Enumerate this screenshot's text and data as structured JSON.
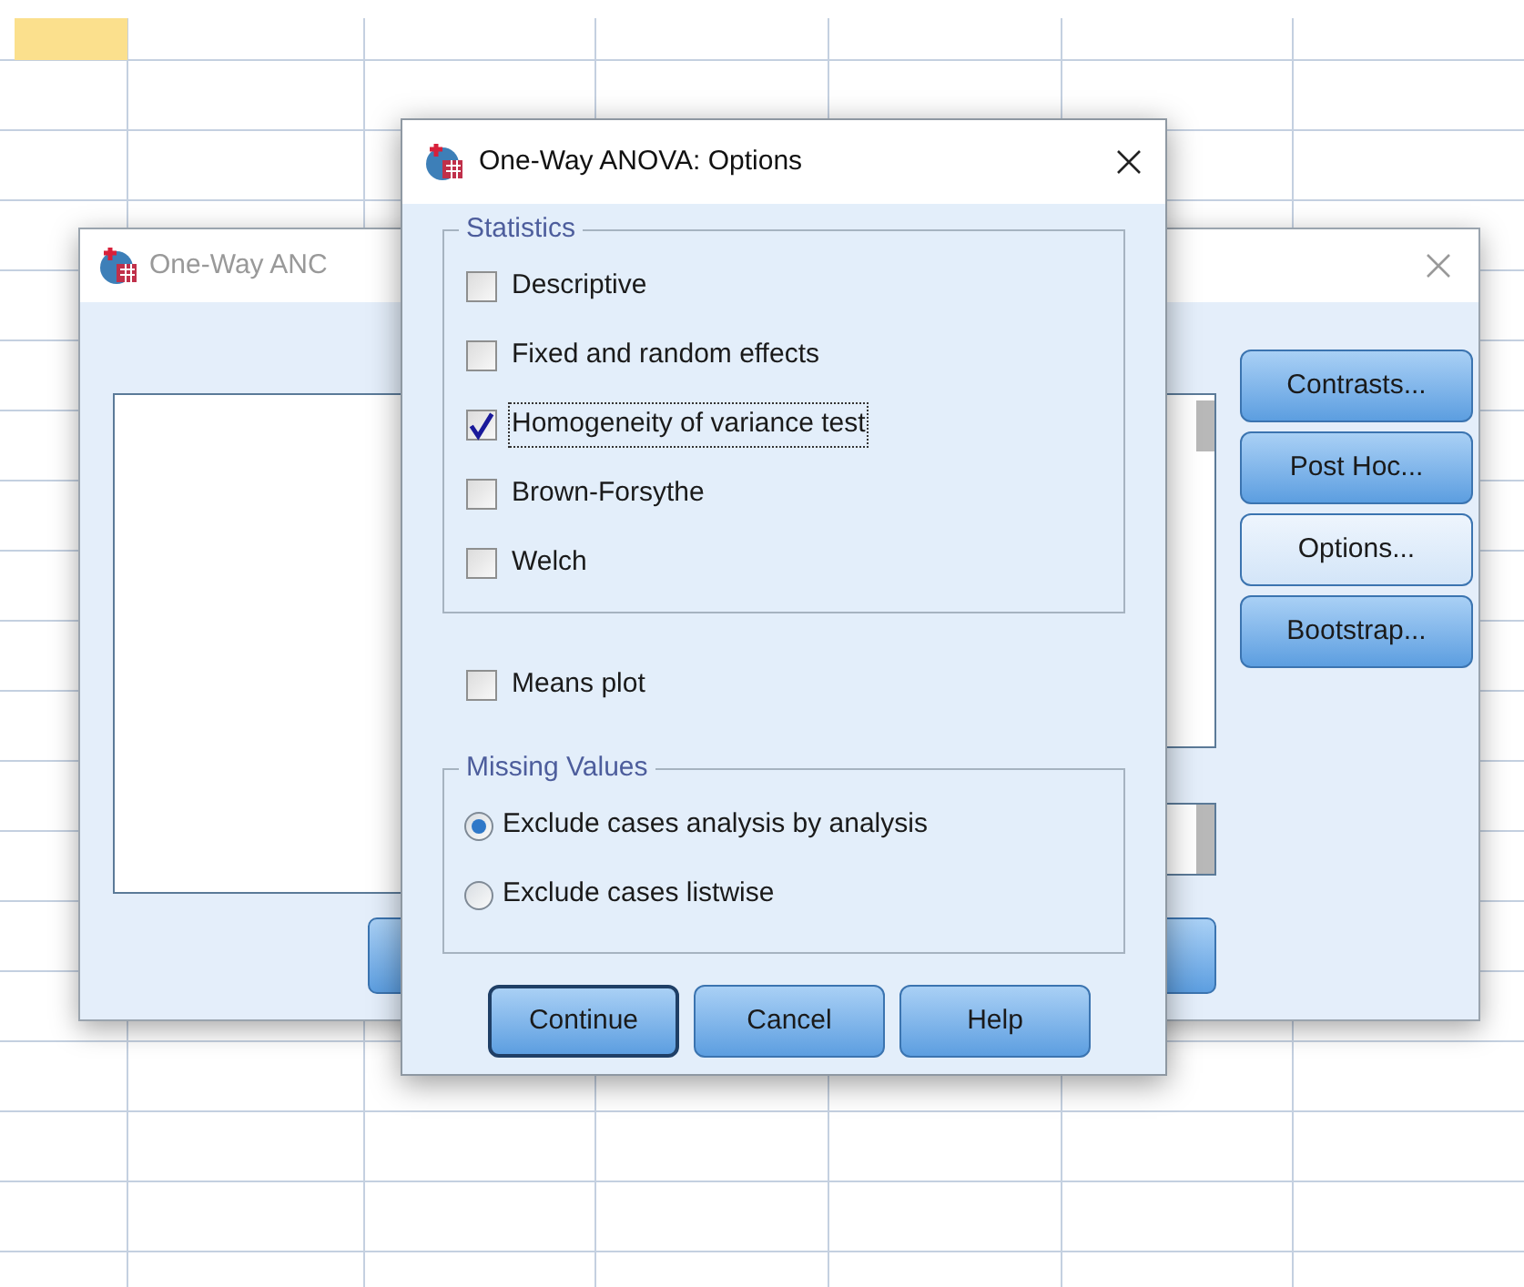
{
  "main_window": {
    "title": "One-Way ANC",
    "buttons": [
      {
        "label": "Contrasts...",
        "selected": false
      },
      {
        "label": "Post Hoc...",
        "selected": false
      },
      {
        "label": "Options...",
        "selected": true
      },
      {
        "label": "Bootstrap...",
        "selected": false
      }
    ]
  },
  "dialog": {
    "title": "One-Way ANOVA: Options",
    "statistics": {
      "title": "Statistics",
      "items": [
        {
          "label": "Descriptive",
          "checked": false,
          "focused": false
        },
        {
          "label": "Fixed and random effects",
          "checked": false,
          "focused": false
        },
        {
          "label": "Homogeneity of variance test",
          "checked": true,
          "focused": true
        },
        {
          "label": "Brown-Forsythe",
          "checked": false,
          "focused": false
        },
        {
          "label": "Welch",
          "checked": false,
          "focused": false
        }
      ]
    },
    "means_plot": {
      "label": "Means plot",
      "checked": false
    },
    "missing_values": {
      "title": "Missing Values",
      "options": [
        {
          "label": "Exclude cases analysis by analysis",
          "selected": true
        },
        {
          "label": "Exclude cases listwise",
          "selected": false
        }
      ]
    },
    "buttons": [
      {
        "label": "Continue",
        "selected": true
      },
      {
        "label": "Cancel",
        "selected": false
      },
      {
        "label": "Help",
        "selected": false
      }
    ]
  }
}
